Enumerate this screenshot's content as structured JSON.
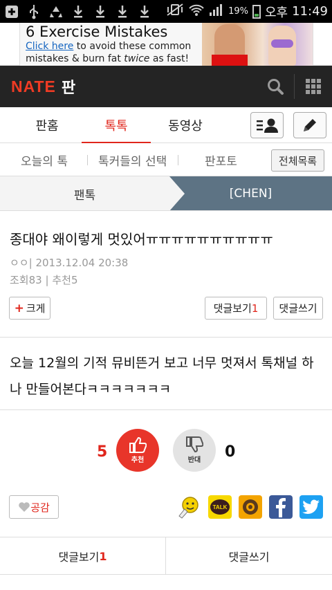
{
  "status_bar": {
    "battery": "19%",
    "ampm": "오후",
    "time": "11:49",
    "icons": [
      "plus-square-icon",
      "usb-icon",
      "recycle-icon",
      "download-icon",
      "download-icon",
      "download-icon",
      "download-icon",
      "vibrate-mute-icon",
      "wifi-icon",
      "signal-icon",
      "battery-icon"
    ]
  },
  "ad": {
    "title": "6 Exercise Mistakes",
    "link": "Click here",
    "line1_rest": " to avoid these common",
    "line2_a": "mistakes & burn fat ",
    "line2_em": "twice",
    "line2_b": " as fast!"
  },
  "header": {
    "logo": "NATE",
    "section": "판",
    "icons": [
      "search-icon",
      "grid-menu-icon"
    ]
  },
  "tabs": [
    {
      "label": "판홈"
    },
    {
      "label": "톡톡",
      "active": true
    },
    {
      "label": "동영상"
    }
  ],
  "subtabs": [
    {
      "label": "오늘의 톡"
    },
    {
      "label": "톡커들의 선택"
    },
    {
      "label": "판포토"
    }
  ],
  "full_list_label": "전체목록",
  "breadcrumb": {
    "left": "팬톡",
    "right": "[CHEN]"
  },
  "post": {
    "title": "종대야 왜이렇게 멋있어ㅠㅠㅠㅠㅠㅠㅠㅠㅠㅠ",
    "author": "ㅇㅇ",
    "date": "2013.12.04 20:38",
    "views_label": "조회",
    "views": "83",
    "recommend_label": "추천",
    "recommend": "5",
    "body": "오늘 12월의 기적 뮤비뜬거 보고 너무 멋져서 톡채널 하나 만들어본다ㅋㅋㅋㅋㅋㅋㅋ"
  },
  "actions": {
    "enlarge_label": "크게",
    "view_comments_label": "댓글보기",
    "comment_count": "1",
    "write_comment_label": "댓글쓰기"
  },
  "vote": {
    "up_count": "5",
    "up_label": "추천",
    "down_count": "0",
    "down_label": "반대"
  },
  "share": {
    "like_label": "공감",
    "kakaotalk_label": "TALK",
    "icons": [
      "emoticon-icon",
      "kakaotalk-icon",
      "kakaostory-icon",
      "facebook-icon",
      "twitter-icon"
    ]
  },
  "colors": {
    "accent": "#e0261c",
    "header_bg": "#242424",
    "breadcrumb_active": "#5d7384",
    "facebook": "#3b5998",
    "twitter": "#1da1f2",
    "kakao": "#f7d800"
  }
}
